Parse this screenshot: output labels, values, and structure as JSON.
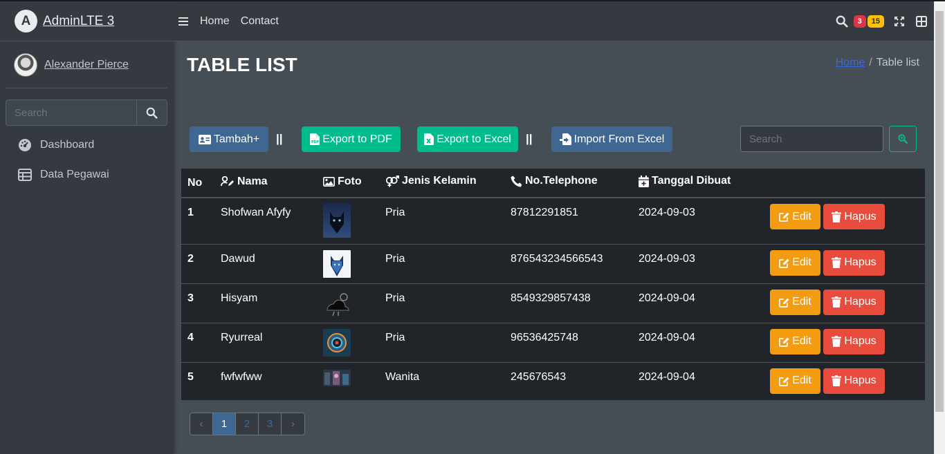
{
  "brand": {
    "name": "AdminLTE 3",
    "logo_letter": "A"
  },
  "user": {
    "name": "Alexander Pierce"
  },
  "sidebar": {
    "search_placeholder": "Search",
    "items": [
      {
        "label": "Dashboard",
        "icon": "dashboard-icon"
      },
      {
        "label": "Data Pegawai",
        "icon": "table-icon"
      }
    ]
  },
  "navbar": {
    "links": [
      "Home",
      "Contact"
    ],
    "badges": {
      "messages": "3",
      "notifications": "15"
    }
  },
  "page": {
    "title": "TABLE LIST",
    "breadcrumb": {
      "home": "Home",
      "separator": "/",
      "current": "Table list"
    }
  },
  "toolbar": {
    "add_label": "Tambah+",
    "separator": "||",
    "export_pdf_label": "Export to PDF",
    "export_excel_label": "Export to Excel",
    "import_excel_label": "Import From Excel",
    "search_placeholder": "Search"
  },
  "table": {
    "headers": [
      "No",
      "Nama",
      "Foto",
      "Jenis Kelamin",
      "No.Telephone",
      "Tanggal Dibuat"
    ],
    "edit_label": "Edit",
    "delete_label": "Hapus",
    "rows": [
      {
        "no": "1",
        "nama": "Shofwan Afyfy",
        "jenis_kelamin": "Pria",
        "telephone": "87812291851",
        "tanggal": "2024-09-03"
      },
      {
        "no": "2",
        "nama": "Dawud",
        "jenis_kelamin": "Pria",
        "telephone": "876543234566543",
        "tanggal": "2024-09-03"
      },
      {
        "no": "3",
        "nama": "Hisyam",
        "jenis_kelamin": "Pria",
        "telephone": "8549329857438",
        "tanggal": "2024-09-04"
      },
      {
        "no": "4",
        "nama": "Ryurreal",
        "jenis_kelamin": "Pria",
        "telephone": "96536425748",
        "tanggal": "2024-09-04"
      },
      {
        "no": "5",
        "nama": "fwfwfww",
        "jenis_kelamin": "Wanita",
        "telephone": "245676543",
        "tanggal": "2024-09-04"
      }
    ]
  },
  "pagination": {
    "prev": "‹",
    "pages": [
      "1",
      "2",
      "3"
    ],
    "next": "›",
    "active": "1"
  },
  "colors": {
    "sidebar": "#343a40",
    "content": "#454d55",
    "primary": "#3f6791",
    "success": "#00bc8c",
    "warning": "#f39c12",
    "danger": "#e74c3c"
  }
}
